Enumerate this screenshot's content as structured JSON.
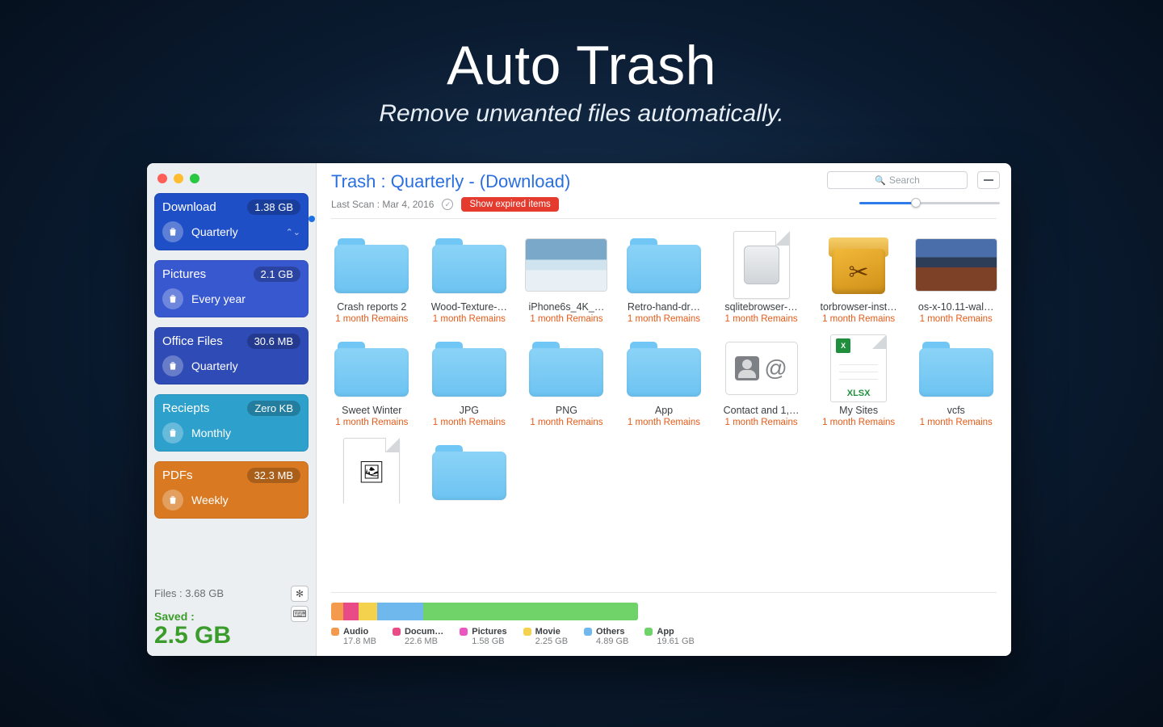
{
  "hero": {
    "title": "Auto Trash",
    "tagline": "Remove unwanted files automatically."
  },
  "colors": {
    "traffic": {
      "close": "#ff5f57",
      "min": "#febc2e",
      "max": "#28c840"
    },
    "cards": [
      "#1f4fc7",
      "#3858d0",
      "#2f4bb6",
      "#2da0cc",
      "#d97a22"
    ]
  },
  "sidebar": {
    "cards": [
      {
        "name": "Download",
        "size": "1.38 GB",
        "freq": "Quarterly",
        "selected": true
      },
      {
        "name": "Pictures",
        "size": "2.1 GB",
        "freq": "Every year",
        "selected": false
      },
      {
        "name": "Office Files",
        "size": "30.6 MB",
        "freq": "Quarterly",
        "selected": false
      },
      {
        "name": "Reciepts",
        "size": "Zero KB",
        "freq": "Monthly",
        "selected": false
      },
      {
        "name": "PDFs",
        "size": "32.3 MB",
        "freq": "Weekly",
        "selected": false
      }
    ],
    "files_label": "Files :",
    "files_total": "3.68 GB",
    "saved_label": "Saved :",
    "saved_value": "2.5 GB"
  },
  "header": {
    "title": "Trash : Quarterly - (Download)",
    "last_scan_label": "Last Scan :",
    "last_scan_value": "Mar 4, 2016",
    "chip": "Show expired items",
    "search_placeholder": "Search"
  },
  "items": [
    {
      "name": "Crash reports 2",
      "remain": "1 month  Remains",
      "kind": "folder"
    },
    {
      "name": "Wood-Texture-…",
      "remain": "1 month  Remains",
      "kind": "folder"
    },
    {
      "name": "iPhone6s_4K_…",
      "remain": "1 month  Remains",
      "kind": "photo"
    },
    {
      "name": "Retro-hand-dr…",
      "remain": "1 month  Remains",
      "kind": "folder"
    },
    {
      "name": "sqlitebrowser-…",
      "remain": "1 month  Remains",
      "kind": "drive"
    },
    {
      "name": "torbrowser-inst…",
      "remain": "1 month  Remains",
      "kind": "box3d"
    },
    {
      "name": "os-x-10.11-wal…",
      "remain": "1 month  Remains",
      "kind": "desert"
    },
    {
      "name": "Sweet Winter",
      "remain": "1 month  Remains",
      "kind": "folder"
    },
    {
      "name": "JPG",
      "remain": "1 month  Remains",
      "kind": "folder"
    },
    {
      "name": "PNG",
      "remain": "1 month  Remains",
      "kind": "folder"
    },
    {
      "name": "App",
      "remain": "1 month  Remains",
      "kind": "folder"
    },
    {
      "name": "Contact and 1,…",
      "remain": "1 month  Remains",
      "kind": "contact"
    },
    {
      "name": "My Sites",
      "remain": "1 month  Remains",
      "kind": "xlsx"
    },
    {
      "name": "vcfs",
      "remain": "1 month  Remains",
      "kind": "folder"
    },
    {
      "name": "",
      "remain": "",
      "kind": "image-file"
    },
    {
      "name": "",
      "remain": "",
      "kind": "folder"
    }
  ],
  "usage": {
    "bar": [
      {
        "color": "#f39a4c",
        "pct": 4
      },
      {
        "color": "#e94b86",
        "pct": 5
      },
      {
        "color": "#f4d24e",
        "pct": 6
      },
      {
        "color": "#6fb8ee",
        "pct": 15
      },
      {
        "color": "#6fd36a",
        "pct": 70
      }
    ],
    "legend": [
      {
        "label": "Audio",
        "size": "17.8 MB",
        "color": "#f39a4c"
      },
      {
        "label": "Docum…",
        "size": "22.6 MB",
        "color": "#e94b86"
      },
      {
        "label": "Pictures",
        "size": "1.58 GB",
        "color": "#ea57c1"
      },
      {
        "label": "Movie",
        "size": "2.25 GB",
        "color": "#f4d24e"
      },
      {
        "label": "Others",
        "size": "4.89 GB",
        "color": "#6fb8ee"
      },
      {
        "label": "App",
        "size": "19.61 GB",
        "color": "#6fd36a"
      }
    ]
  }
}
